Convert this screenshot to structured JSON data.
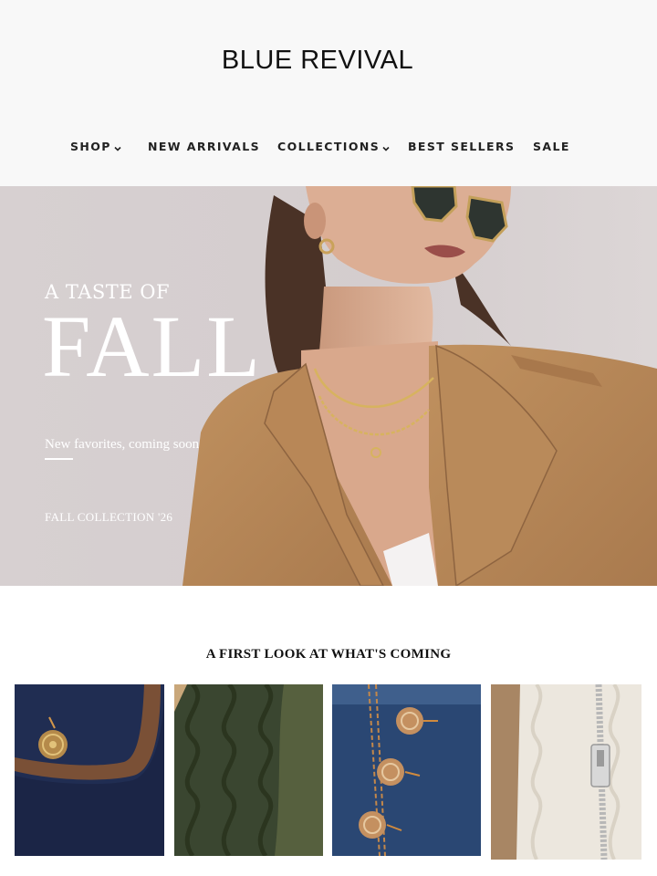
{
  "brand": {
    "name": "BLUE REVIVAL"
  },
  "nav": {
    "items": [
      {
        "label": "SHOP",
        "has_dropdown": true
      },
      {
        "label": "NEW ARRIVALS",
        "has_dropdown": false
      },
      {
        "label": "COLLECTIONS",
        "has_dropdown": true
      },
      {
        "label": "BEST SELLERS",
        "has_dropdown": false
      },
      {
        "label": "SALE",
        "has_dropdown": false
      }
    ]
  },
  "hero": {
    "kicker": "A TASTE OF",
    "title": "FALL",
    "subtitle": "New favorites, coming soon",
    "collection": "FALL COLLECTION '26"
  },
  "preview": {
    "title": "A FIRST LOOK AT WHAT'S COMING",
    "tiles": [
      {
        "subject": "navy denim with gold crest button and suede trim"
      },
      {
        "subject": "olive cable-knit sweater"
      },
      {
        "subject": "denim with crested gold buttons"
      },
      {
        "subject": "cream cable knit with silver zipper"
      }
    ]
  },
  "colors": {
    "header_bg": "#f8f8f8",
    "hero_bg": "#d6cfd0",
    "coat_camel": "#b5865a",
    "text_dark": "#111111"
  }
}
